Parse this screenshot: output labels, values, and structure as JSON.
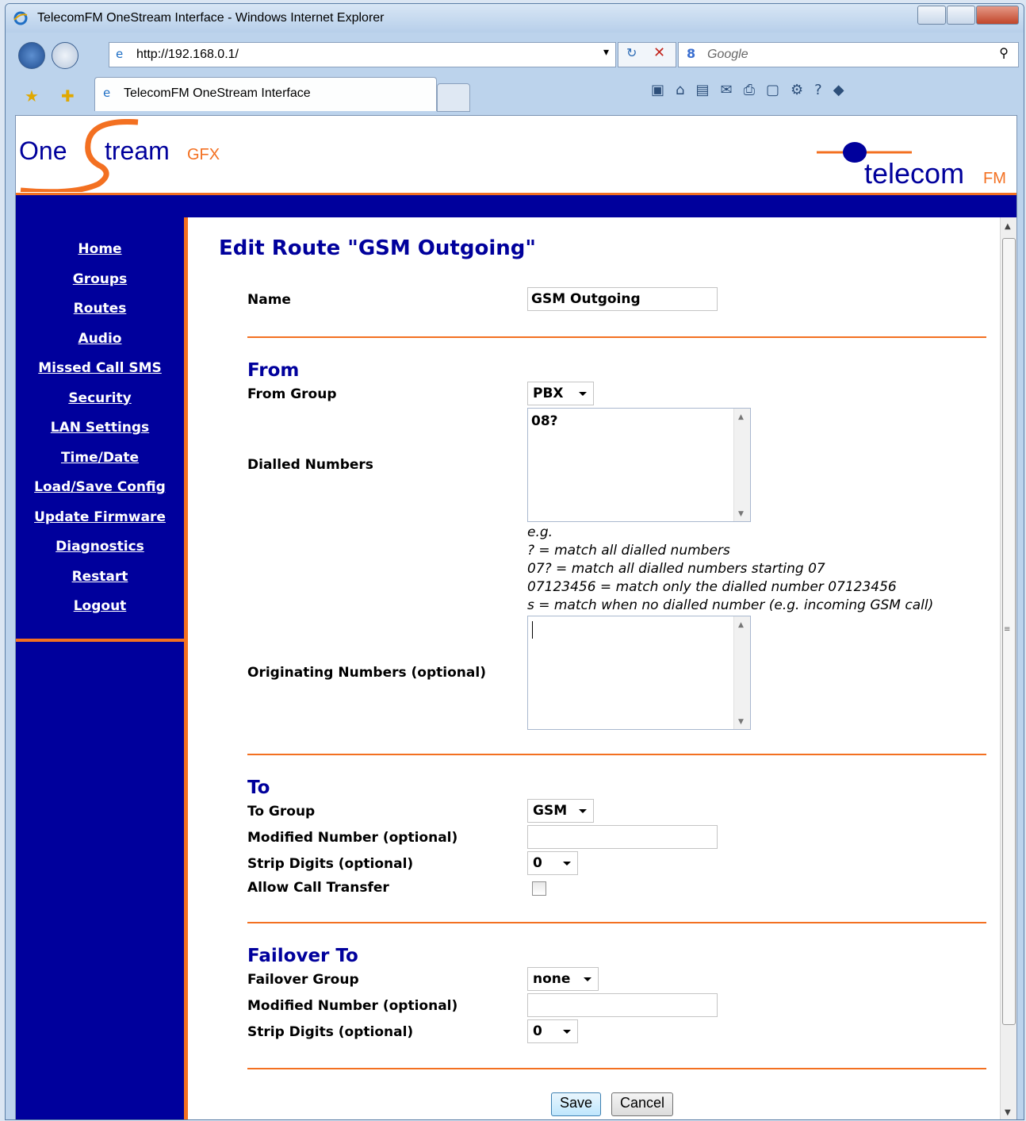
{
  "window": {
    "title": "TelecomFM OneStream Interface - Windows Internet Explorer"
  },
  "browser": {
    "url": "http://192.168.0.1/",
    "search_placeholder": "Google",
    "tab_title": "TelecomFM OneStream Interface"
  },
  "logo": {
    "left_one": "One",
    "left_tream": "tream",
    "left_gfx": "GFX",
    "right_telecom": "telecom",
    "right_fm": "FM"
  },
  "sidebar": {
    "items": [
      {
        "label": "Home"
      },
      {
        "label": "Groups"
      },
      {
        "label": "Routes"
      },
      {
        "label": "Audio"
      },
      {
        "label": "Missed Call SMS"
      },
      {
        "label": "Security"
      },
      {
        "label": "LAN Settings"
      },
      {
        "label": "Time/Date"
      },
      {
        "label": "Load/Save Config"
      },
      {
        "label": "Update Firmware"
      },
      {
        "label": "Diagnostics"
      },
      {
        "label": "Restart"
      },
      {
        "label": "Logout"
      }
    ]
  },
  "page": {
    "title": "Edit Route \"GSM Outgoing\"",
    "name_label": "Name",
    "name_value": "GSM Outgoing",
    "from": {
      "heading": "From",
      "group_label": "From Group",
      "group_value": "PBX",
      "dialled_label": "Dialled Numbers",
      "dialled_value": "08?",
      "hints": [
        "e.g.",
        "? = match all dialled numbers",
        "07? = match all dialled numbers starting 07",
        "07123456 = match only the dialled number 07123456",
        "s = match when no dialled number (e.g. incoming GSM call)"
      ],
      "originating_label": "Originating Numbers (optional)",
      "originating_value": ""
    },
    "to": {
      "heading": "To",
      "group_label": "To Group",
      "group_value": "GSM",
      "modified_label": "Modified Number (optional)",
      "modified_value": "",
      "strip_label": "Strip Digits (optional)",
      "strip_value": "0",
      "transfer_label": "Allow Call Transfer",
      "transfer_checked": false
    },
    "failover": {
      "heading": "Failover To",
      "group_label": "Failover Group",
      "group_value": "none",
      "modified_label": "Modified Number (optional)",
      "modified_value": "",
      "strip_label": "Strip Digits (optional)",
      "strip_value": "0"
    },
    "buttons": {
      "save": "Save",
      "cancel": "Cancel"
    }
  },
  "colors": {
    "navy": "#00009c",
    "orange": "#f37021"
  }
}
